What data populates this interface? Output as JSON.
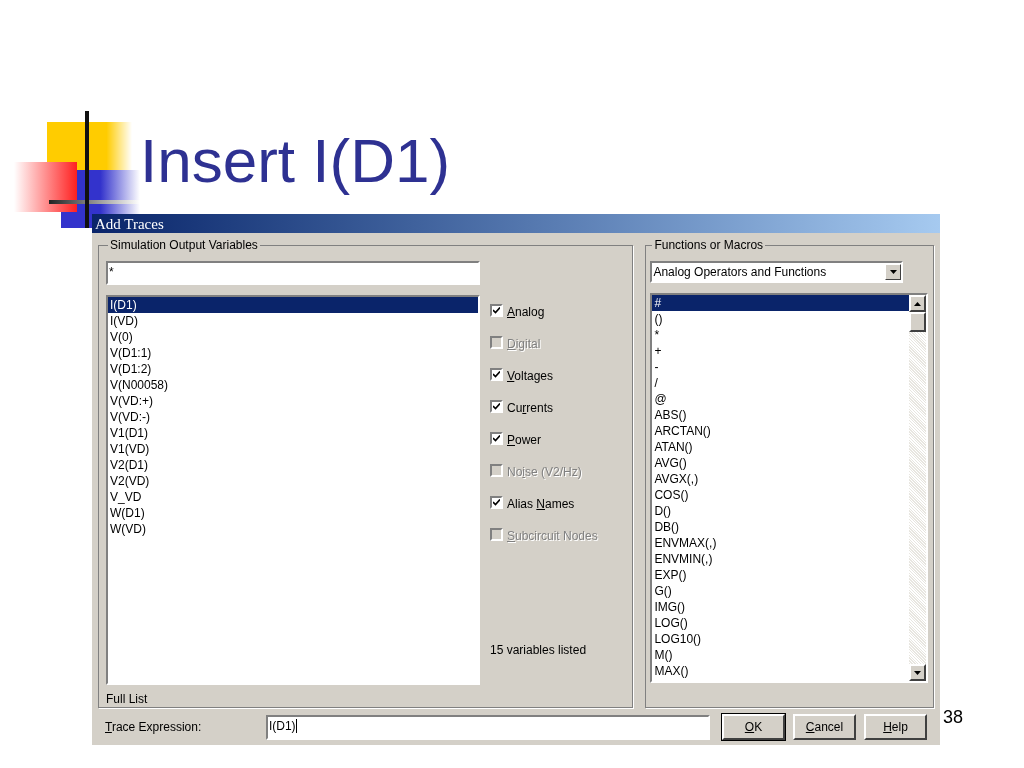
{
  "slide": {
    "title": "Insert I(D1)",
    "page_number": "38"
  },
  "dialog": {
    "title": "Add Traces",
    "variables": {
      "label": "Simulation Output Variables",
      "filter": "*",
      "footer": "Full List",
      "items": [
        {
          "text": "I(D1)",
          "selected": true
        },
        {
          "text": "I(VD)",
          "selected": false
        },
        {
          "text": "V(0)",
          "selected": false
        },
        {
          "text": "V(D1:1)",
          "selected": false
        },
        {
          "text": "V(D1:2)",
          "selected": false
        },
        {
          "text": "V(N00058)",
          "selected": false
        },
        {
          "text": "V(VD:+)",
          "selected": false
        },
        {
          "text": "V(VD:-)",
          "selected": false
        },
        {
          "text": "V1(D1)",
          "selected": false
        },
        {
          "text": "V1(VD)",
          "selected": false
        },
        {
          "text": "V2(D1)",
          "selected": false
        },
        {
          "text": "V2(VD)",
          "selected": false
        },
        {
          "text": "V_VD",
          "selected": false
        },
        {
          "text": "W(D1)",
          "selected": false
        },
        {
          "text": "W(VD)",
          "selected": false
        }
      ]
    },
    "filters": [
      {
        "key": "A",
        "post": "nalog",
        "checked": true,
        "disabled": false
      },
      {
        "key": "D",
        "post": "igital",
        "checked": false,
        "disabled": true
      },
      {
        "key": "V",
        "post": "oltages",
        "checked": true,
        "disabled": false
      },
      {
        "pre": "Cu",
        "key": "r",
        "post": "rents",
        "checked": true,
        "disabled": false
      },
      {
        "key": "P",
        "post": "ower",
        "checked": true,
        "disabled": false
      },
      {
        "pre": "No",
        "key": "i",
        "post": "se (V2/Hz)",
        "checked": false,
        "disabled": true
      },
      {
        "pre": "Alias ",
        "key": "N",
        "post": "ames",
        "checked": true,
        "disabled": false
      },
      {
        "key": "S",
        "post": "ubcircuit Nodes",
        "checked": false,
        "disabled": true
      }
    ],
    "count": "15 variables listed",
    "functions": {
      "label": "Functions or Macros",
      "dropdown": "Analog Operators and Functions",
      "items": [
        {
          "text": "#",
          "selected": true
        },
        {
          "text": "()",
          "selected": false
        },
        {
          "text": "*",
          "selected": false
        },
        {
          "text": "+",
          "selected": false
        },
        {
          "text": "-",
          "selected": false
        },
        {
          "text": "/",
          "selected": false
        },
        {
          "text": "@",
          "selected": false
        },
        {
          "text": "ABS()",
          "selected": false
        },
        {
          "text": "ARCTAN()",
          "selected": false
        },
        {
          "text": "ATAN()",
          "selected": false
        },
        {
          "text": "AVG()",
          "selected": false
        },
        {
          "text": "AVGX(,)",
          "selected": false
        },
        {
          "text": "COS()",
          "selected": false
        },
        {
          "text": "D()",
          "selected": false
        },
        {
          "text": "DB()",
          "selected": false
        },
        {
          "text": "ENVMAX(,)",
          "selected": false
        },
        {
          "text": "ENVMIN(,)",
          "selected": false
        },
        {
          "text": "EXP()",
          "selected": false
        },
        {
          "text": "G()",
          "selected": false
        },
        {
          "text": "IMG()",
          "selected": false
        },
        {
          "text": "LOG()",
          "selected": false
        },
        {
          "text": "LOG10()",
          "selected": false
        },
        {
          "text": "M()",
          "selected": false
        },
        {
          "text": "MAX()",
          "selected": false
        }
      ]
    },
    "trace_expression": {
      "key": "T",
      "post": "race Expression:",
      "value": "I(D1)"
    },
    "buttons": [
      {
        "key": "O",
        "post": "K"
      },
      {
        "key": "C",
        "post": "ancel"
      },
      {
        "key": "H",
        "post": "elp"
      }
    ]
  }
}
